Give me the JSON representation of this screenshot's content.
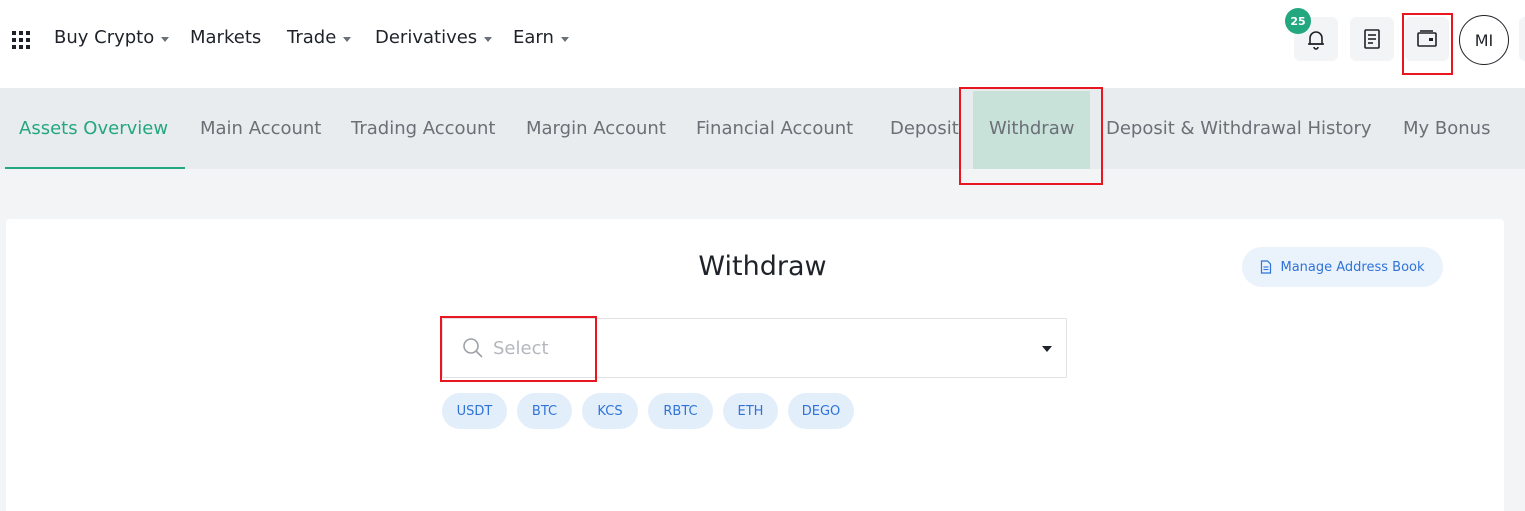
{
  "nav": {
    "items": [
      {
        "label": "Buy Crypto",
        "dropdown": true
      },
      {
        "label": "Markets",
        "dropdown": false
      },
      {
        "label": "Trade",
        "dropdown": true
      },
      {
        "label": "Derivatives",
        "dropdown": true
      },
      {
        "label": "Earn",
        "dropdown": true
      }
    ],
    "notification_count": "25",
    "avatar_initials": "MI",
    "icons": [
      "apps-grid-icon",
      "bell-icon",
      "orders-icon",
      "wallet-icon"
    ]
  },
  "tabs": [
    {
      "label": "Assets Overview",
      "active": true
    },
    {
      "label": "Main Account"
    },
    {
      "label": "Trading Account"
    },
    {
      "label": "Margin Account"
    },
    {
      "label": "Financial Account"
    },
    {
      "label": "Deposit"
    },
    {
      "label": "Withdraw",
      "highlighted": true
    },
    {
      "label": "Deposit & Withdrawal History"
    },
    {
      "label": "My Bonus"
    }
  ],
  "withdraw": {
    "title": "Withdraw",
    "manage_address_book": "Manage Address Book",
    "select_placeholder": "Select",
    "coins": [
      "USDT",
      "BTC",
      "KCS",
      "RBTC",
      "ETH",
      "DEGO"
    ]
  },
  "colors": {
    "accent": "#23a77f",
    "link": "#2f73d9",
    "annotation": "#e8171f"
  }
}
